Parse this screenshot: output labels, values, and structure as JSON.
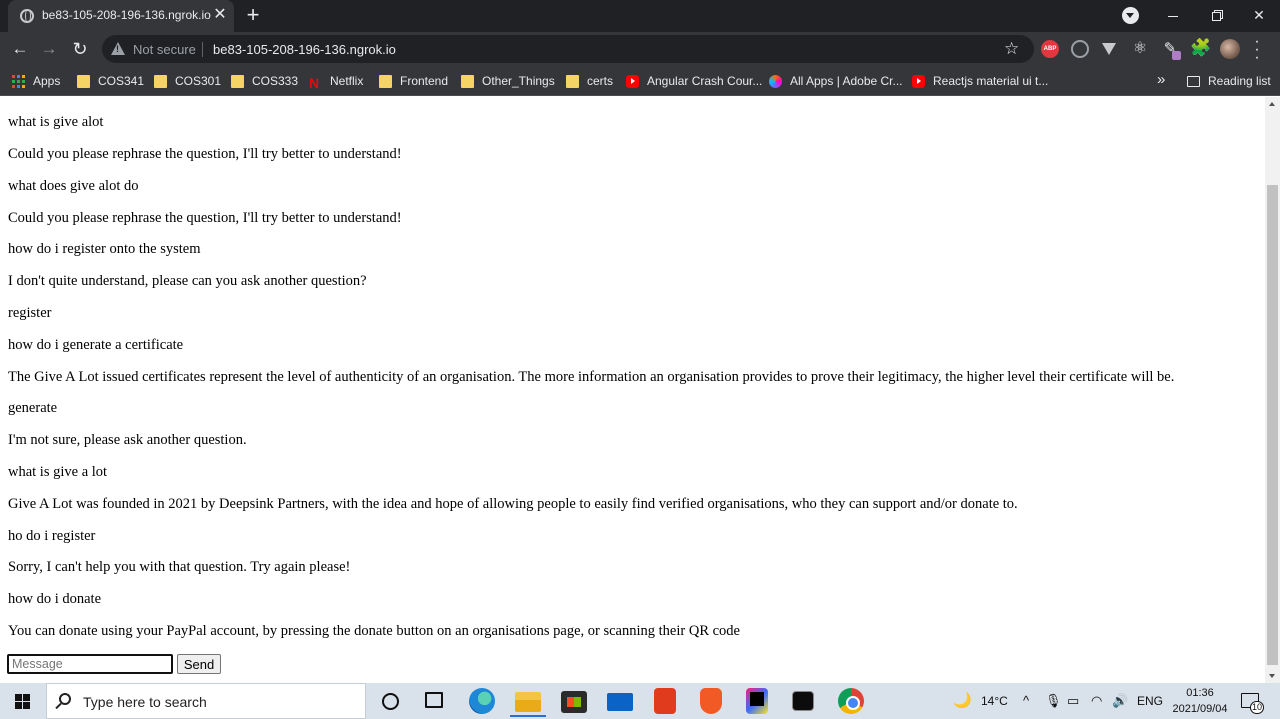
{
  "browser": {
    "tab": {
      "title": "be83-105-208-196-136.ngrok.io",
      "close_glyph": "✕"
    },
    "new_tab_glyph": "+",
    "address": {
      "security_label": "Not secure",
      "url": "be83-105-208-196-136.ngrok.io"
    },
    "extensions": [
      {
        "name": "adblock-plus-icon",
        "label": "ABP"
      }
    ],
    "bookmarks": [
      {
        "label": "Apps",
        "icon": "apps-grid-icon"
      },
      {
        "label": "COS341",
        "icon": "folder-icon"
      },
      {
        "label": "COS301",
        "icon": "folder-icon"
      },
      {
        "label": "COS333",
        "icon": "folder-icon"
      },
      {
        "label": "Netflix",
        "icon": "netflix-icon",
        "glyph": "N"
      },
      {
        "label": "Frontend",
        "icon": "folder-icon"
      },
      {
        "label": "Other_Things",
        "icon": "folder-icon"
      },
      {
        "label": "certs",
        "icon": "folder-icon"
      },
      {
        "label": "Angular Crash Cour...",
        "icon": "youtube-icon"
      },
      {
        "label": "All Apps | Adobe Cr...",
        "icon": "adobe-icon"
      },
      {
        "label": "Reactjs material ui t...",
        "icon": "youtube-icon"
      }
    ],
    "bookmarks_overflow_glyph": "»",
    "reading_list_label": "Reading list"
  },
  "chat": {
    "messages": [
      "what is give alot",
      "Could you please rephrase the question, I'll try better to understand!",
      "what does give alot do",
      "Could you please rephrase the question, I'll try better to understand!",
      "how do i register onto the system",
      "I don't quite understand, please can you ask another question?",
      "register",
      "how do i generate a certificate",
      "The Give A Lot issued certificates represent the level of authenticity of an organisation. The more information an organisation provides to prove their legitimacy, the higher level their certificate will be.",
      "generate",
      "I'm not sure, please ask another question.",
      "what is give a lot",
      "Give A Lot was founded in 2021 by Deepsink Partners, with the idea and hope of allowing people to easily find verified organisations, who they can support and/or donate to.",
      "ho do i register",
      "Sorry, I can't help you with that question. Try again please!",
      "how do i donate",
      "You can donate using your PayPal account, by pressing the donate button on an organisations page, or scanning their QR code"
    ],
    "input": {
      "placeholder": "Message",
      "value": ""
    },
    "send_label": "Send"
  },
  "taskbar": {
    "search_placeholder": "Type here to search",
    "weather": {
      "icon": "moon-icon",
      "temperature": "14°C"
    },
    "language": "ENG",
    "time": "01:36",
    "date": "2021/09/04",
    "notification_count": "10"
  }
}
